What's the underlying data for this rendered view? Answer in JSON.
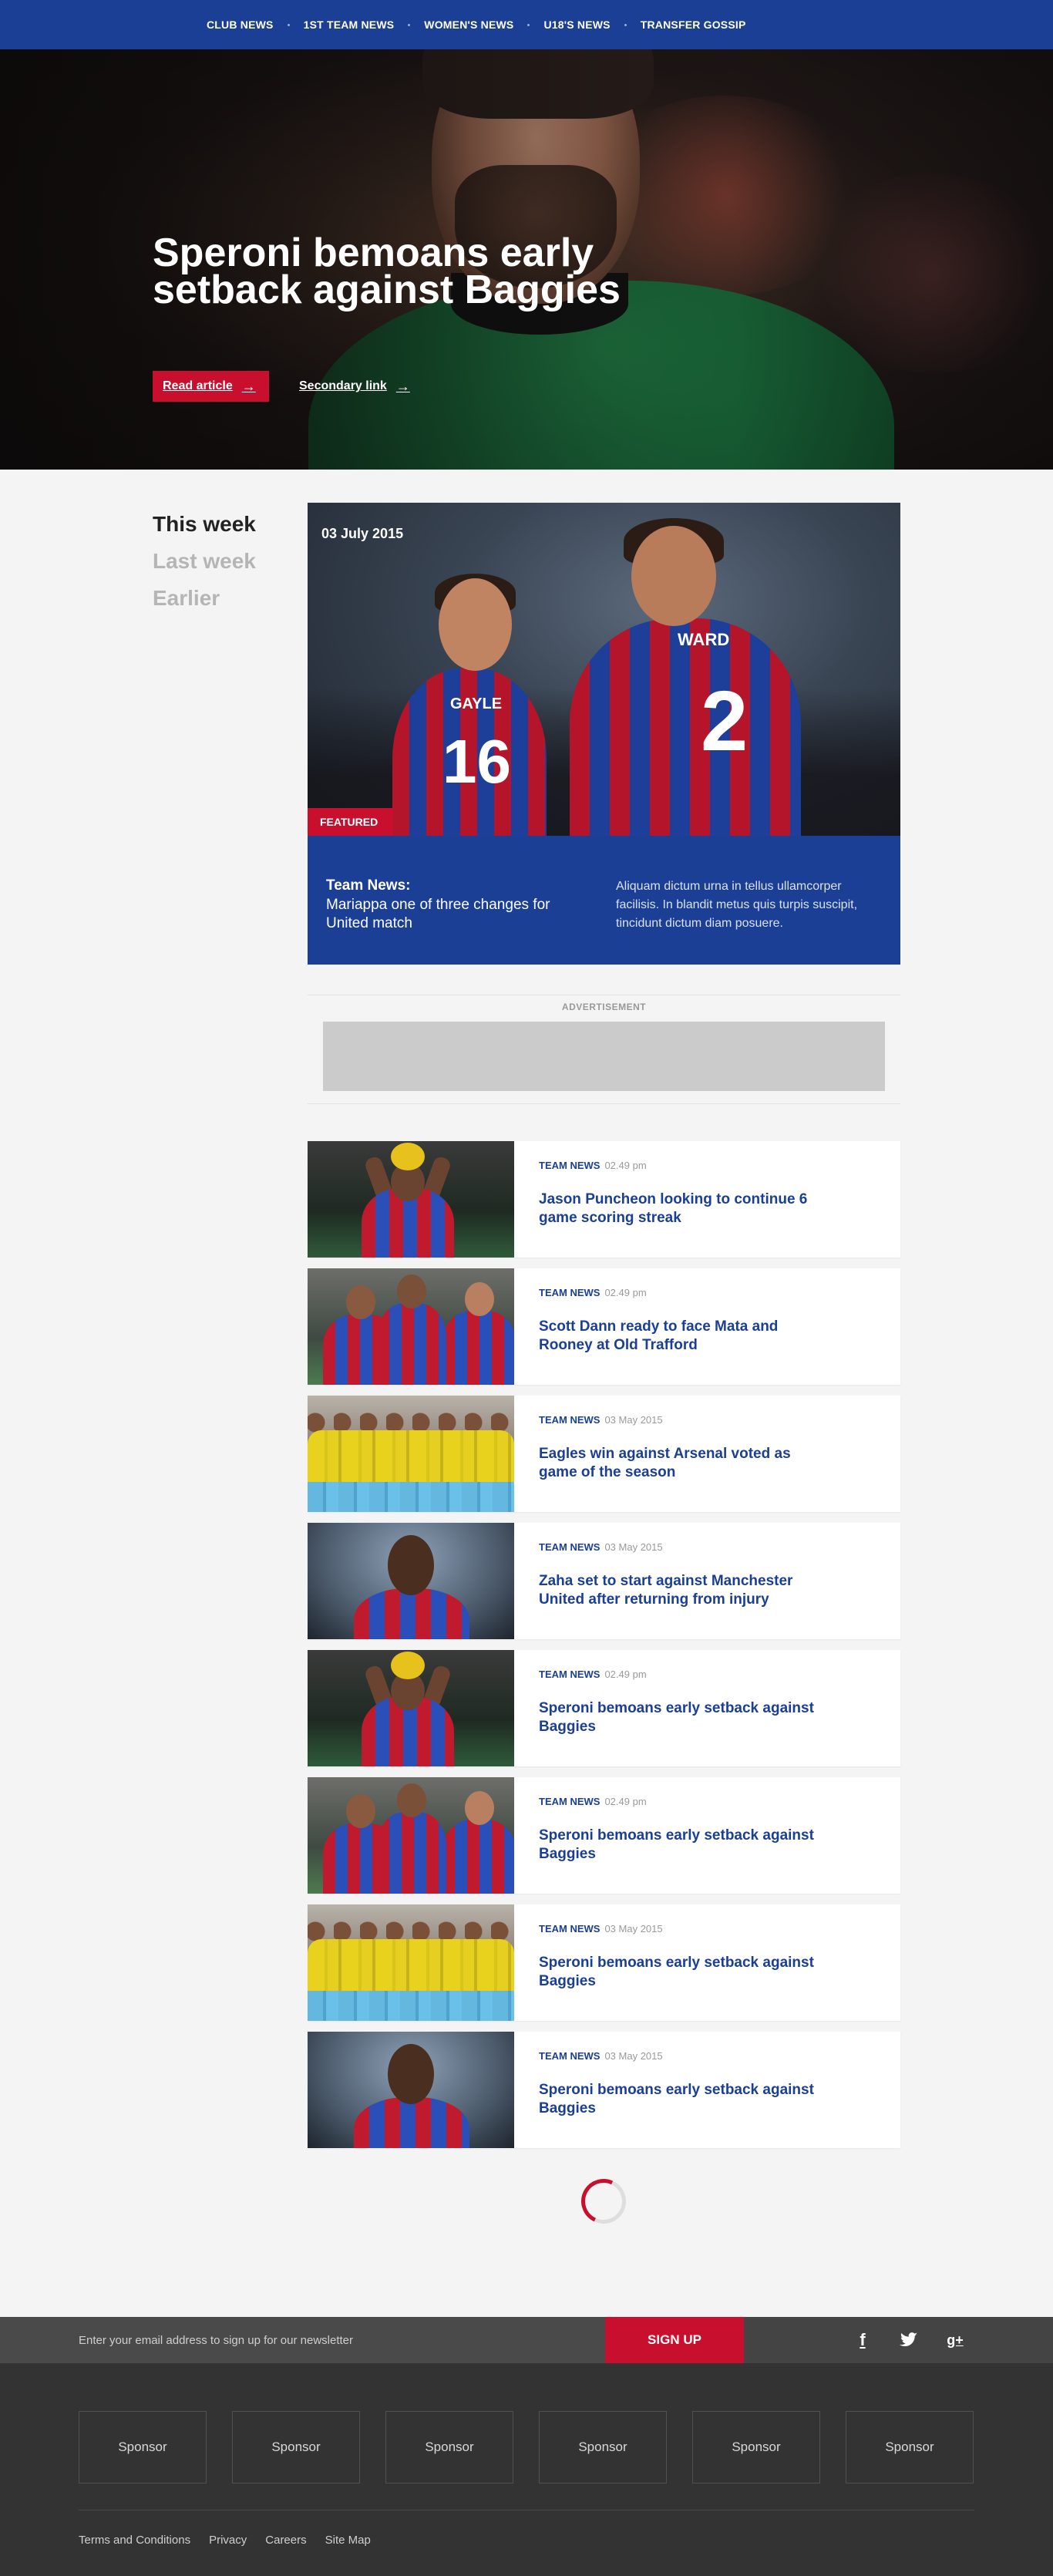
{
  "nav": {
    "items": [
      {
        "label": "CLUB NEWS"
      },
      {
        "label": "1ST TEAM NEWS"
      },
      {
        "label": "WOMEN'S NEWS"
      },
      {
        "label": "U18'S NEWS"
      },
      {
        "label": "TRANSFER GOSSIP"
      }
    ]
  },
  "hero": {
    "headline": "Speroni bemoans early setback against Baggies",
    "read_label": "Read article",
    "secondary_label": "Secondary link",
    "arrow": "→"
  },
  "filter": {
    "items": [
      {
        "label": "This week",
        "active": true
      },
      {
        "label": "Last week",
        "active": false
      },
      {
        "label": "Earlier",
        "active": false
      }
    ]
  },
  "featured": {
    "date": "03 July 2015",
    "badge": "FEATURED",
    "jersey_name_1": "GAYLE",
    "jersey_num_1": "16",
    "jersey_name_2": "WARD",
    "jersey_num_2": "2",
    "title": "Team News:",
    "subtitle": "Mariappa one of three changes for United match",
    "description": "Aliquam dictum urna in tellus ullamcorper facilisis. In blandit metus quis turpis suscipit, tincidunt dictum diam posuere."
  },
  "ad": {
    "label": "ADVERTISEMENT"
  },
  "articles": [
    {
      "category": "TEAM NEWS",
      "time": "02.49 pm",
      "title": "Jason Puncheon looking to continue 6 game scoring streak",
      "thumb": "ball"
    },
    {
      "category": "TEAM NEWS",
      "time": "02.49 pm",
      "title": "Scott Dann ready to face Mata and Rooney at Old Trafford",
      "thumb": "pair"
    },
    {
      "category": "TEAM NEWS",
      "time": "03 May 2015",
      "title": "Eagles win against Arsenal voted as game of the season",
      "thumb": "team"
    },
    {
      "category": "TEAM NEWS",
      "time": "03 May 2015",
      "title": "Zaha set to start against Manchester United after returning from injury",
      "thumb": "portrait"
    },
    {
      "category": "TEAM NEWS",
      "time": "02.49 pm",
      "title": "Speroni bemoans early setback against Baggies",
      "thumb": "ball"
    },
    {
      "category": "TEAM NEWS",
      "time": "02.49 pm",
      "title": "Speroni bemoans early setback against Baggies",
      "thumb": "pair"
    },
    {
      "category": "TEAM NEWS",
      "time": "03 May 2015",
      "title": "Speroni bemoans early setback against Baggies",
      "thumb": "team"
    },
    {
      "category": "TEAM NEWS",
      "time": "03 May 2015",
      "title": "Speroni bemoans early setback against Baggies",
      "thumb": "portrait"
    }
  ],
  "newsletter": {
    "placeholder": "Enter your email address to sign up for our newsletter",
    "button": "SIGN UP",
    "social": [
      {
        "icon": "facebook-icon",
        "glyph": "f"
      },
      {
        "icon": "twitter-icon",
        "glyph": "🐦"
      },
      {
        "icon": "google-plus-icon",
        "glyph": "g+"
      }
    ]
  },
  "footer": {
    "sponsors": [
      "Sponsor",
      "Sponsor",
      "Sponsor",
      "Sponsor",
      "Sponsor",
      "Sponsor"
    ],
    "links": [
      "Terms and Conditions",
      "Privacy",
      "Careers",
      "Site Map"
    ]
  },
  "colors": {
    "brand_blue": "#1b3f94",
    "brand_red": "#c8102e",
    "footer_bg": "#333333"
  }
}
